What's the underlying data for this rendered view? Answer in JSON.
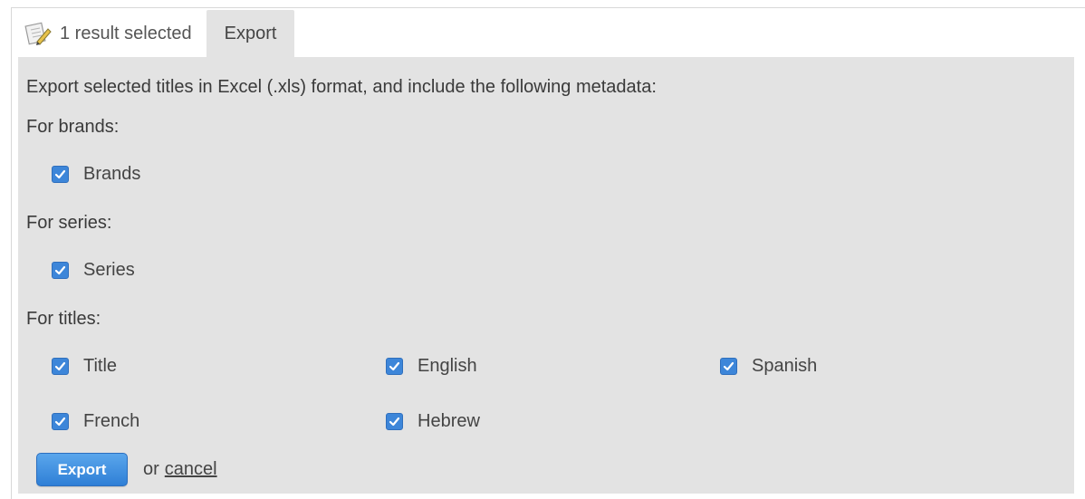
{
  "tabs": {
    "selected_label": "1 result selected",
    "export_label": "Export"
  },
  "panel": {
    "intro": "Export selected titles in Excel (.xls) format, and include the following metadata:",
    "groups": [
      {
        "label": "For brands:",
        "options": [
          {
            "label": "Brands",
            "checked": true
          }
        ]
      },
      {
        "label": "For series:",
        "options": [
          {
            "label": "Series",
            "checked": true
          }
        ]
      },
      {
        "label": "For titles:",
        "options": [
          {
            "label": "Title",
            "checked": true
          },
          {
            "label": "English",
            "checked": true
          },
          {
            "label": "Spanish",
            "checked": true
          },
          {
            "label": "French",
            "checked": true
          },
          {
            "label": "Hebrew",
            "checked": true
          }
        ]
      }
    ]
  },
  "actions": {
    "export_button": "Export",
    "or_text": "or",
    "cancel_link": "cancel"
  },
  "colors": {
    "panel_bg": "#e3e3e3",
    "checkbox_accent": "#3d86d9",
    "button_accent": "#2f7fd6"
  }
}
